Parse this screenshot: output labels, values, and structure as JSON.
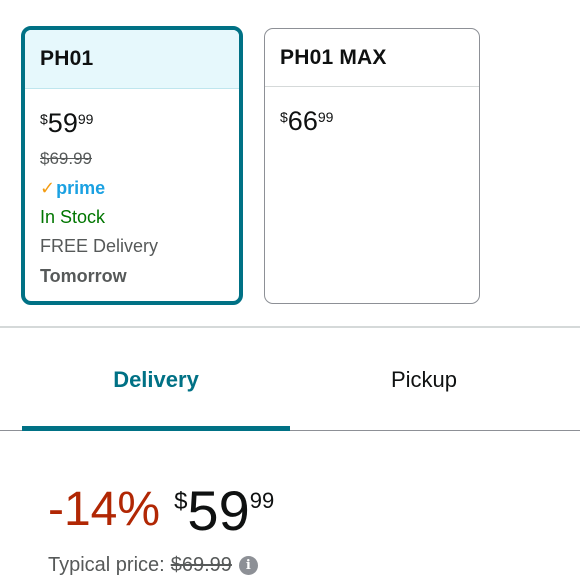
{
  "variants": [
    {
      "name": "PH01",
      "price": {
        "symbol": "$",
        "whole": "59",
        "fraction": "99"
      },
      "list_price": "$69.99",
      "prime_check": "✓",
      "prime_label": "prime",
      "stock": "In Stock",
      "delivery": "FREE Delivery",
      "delivery_date": "Tomorrow",
      "selected": true
    },
    {
      "name": "PH01 MAX",
      "price": {
        "symbol": "$",
        "whole": "66",
        "fraction": "99"
      },
      "selected": false
    }
  ],
  "tabs": [
    {
      "label": "Delivery",
      "active": true
    },
    {
      "label": "Pickup",
      "active": false
    }
  ],
  "price_block": {
    "discount": "-14%",
    "symbol": "$",
    "whole": "59",
    "fraction": "99",
    "typical_label": "Typical price:",
    "typical_value": "$69.99",
    "info_glyph": "i"
  },
  "colors": {
    "accent": "#007185",
    "deal_red": "#b12704",
    "in_stock_green": "#007600",
    "prime_blue": "#1ba1e2",
    "prime_check_orange": "#f39c12"
  },
  "icons": {
    "prime_check": "check-icon",
    "info": "info-icon"
  }
}
